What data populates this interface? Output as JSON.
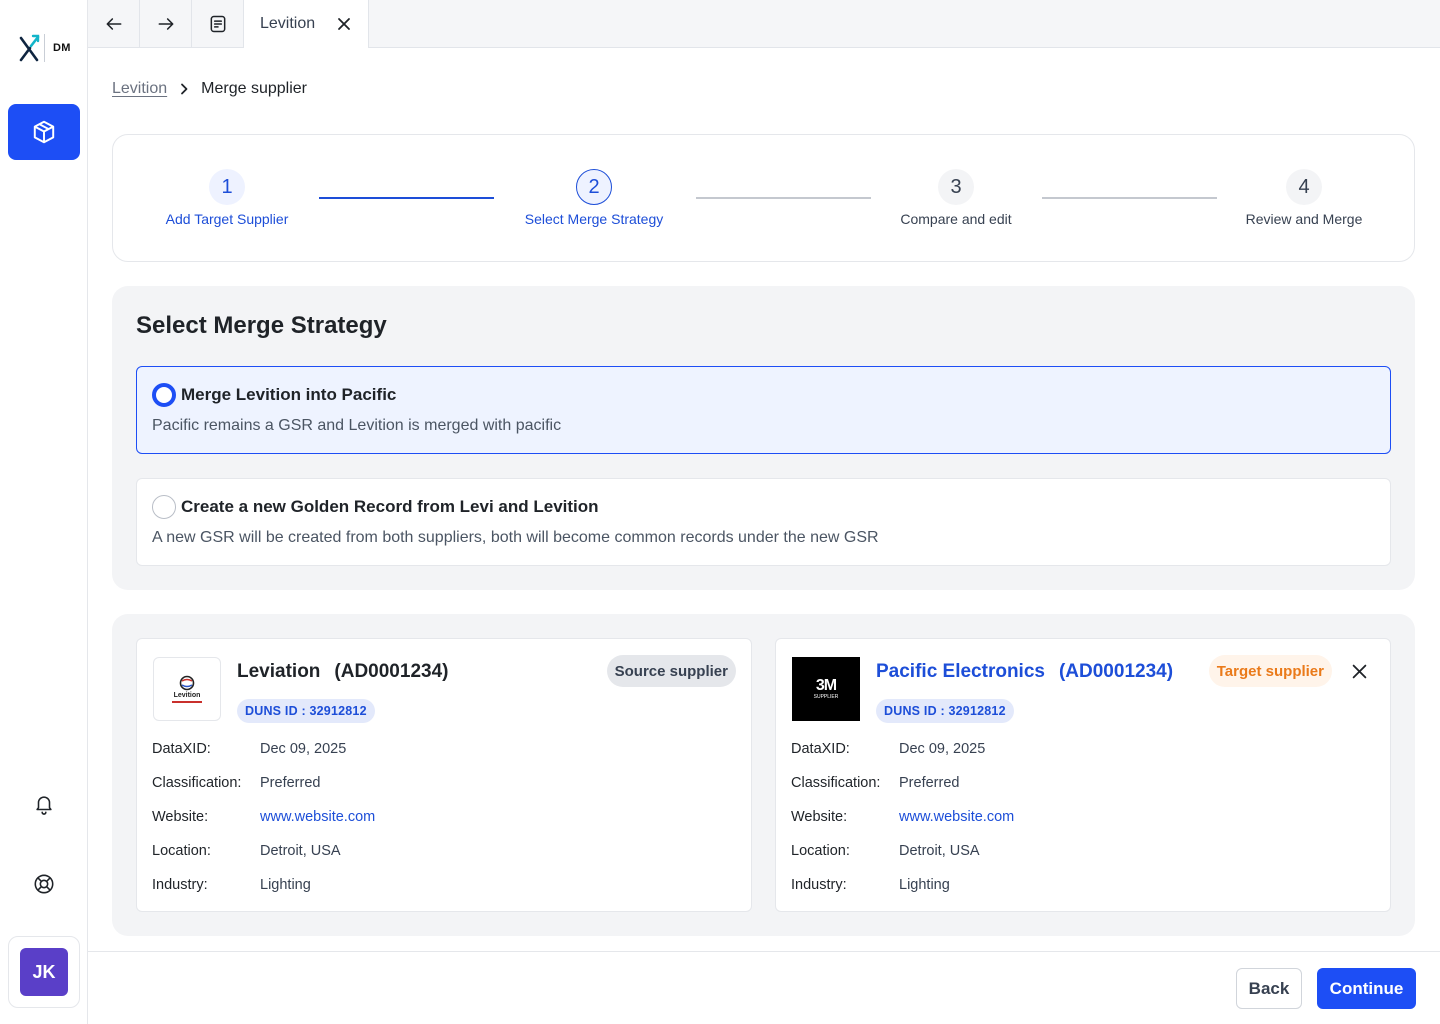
{
  "app": {
    "logo_text": "DM"
  },
  "sidebar": {
    "avatar_initials": "JK"
  },
  "tabs": {
    "active_tab": "Levition"
  },
  "breadcrumb": {
    "parent": "Levition",
    "current": "Merge supplier"
  },
  "stepper": {
    "steps": [
      {
        "number": "1",
        "label": "Add Target Supplier",
        "state": "done"
      },
      {
        "number": "2",
        "label": "Select Merge Strategy",
        "state": "current"
      },
      {
        "number": "3",
        "label": "Compare and edit",
        "state": "todo"
      },
      {
        "number": "4",
        "label": "Review and Merge",
        "state": "todo"
      }
    ]
  },
  "strategy": {
    "title": "Select Merge Strategy",
    "options": [
      {
        "title": "Merge Levition into Pacific",
        "description": "Pacific remains a GSR and Levition is merged with pacific",
        "selected": true
      },
      {
        "title": "Create a new Golden Record from Levi and Levition",
        "description": "A new GSR will be created from both suppliers, both will become common records under the new GSR",
        "selected": false
      }
    ]
  },
  "source": {
    "logo_text": "Levition",
    "name": "Leviation",
    "id": "(AD0001234)",
    "badge": "Source supplier",
    "duns": "DUNS ID : 32912812",
    "fields": [
      {
        "label": "DataXID:",
        "value": "Dec 09, 2025"
      },
      {
        "label": "Classification:",
        "value": "Preferred"
      },
      {
        "label": "Website:",
        "value": "www.website.com"
      },
      {
        "label": "Location:",
        "value": "Detroit, USA"
      },
      {
        "label": "Industry:",
        "value": "Lighting"
      }
    ]
  },
  "target": {
    "logo_text": "3M",
    "logo_subtext": "SUPPLIER",
    "name": "Pacific Electronics",
    "id": "(AD0001234)",
    "badge": "Target supplier",
    "duns": "DUNS ID : 32912812",
    "fields": [
      {
        "label": "DataXID:",
        "value": "Dec 09, 2025"
      },
      {
        "label": "Classification:",
        "value": "Preferred"
      },
      {
        "label": "Website:",
        "value": "www.website.com"
      },
      {
        "label": "Location:",
        "value": "Detroit, USA"
      },
      {
        "label": "Industry:",
        "value": "Lighting"
      }
    ]
  },
  "footer": {
    "back_label": "Back",
    "continue_label": "Continue"
  },
  "colors": {
    "primary": "#1d4ef5",
    "link": "#1d4ed8",
    "target_badge": "#ea7a1a",
    "avatar": "#5a3fc8"
  }
}
